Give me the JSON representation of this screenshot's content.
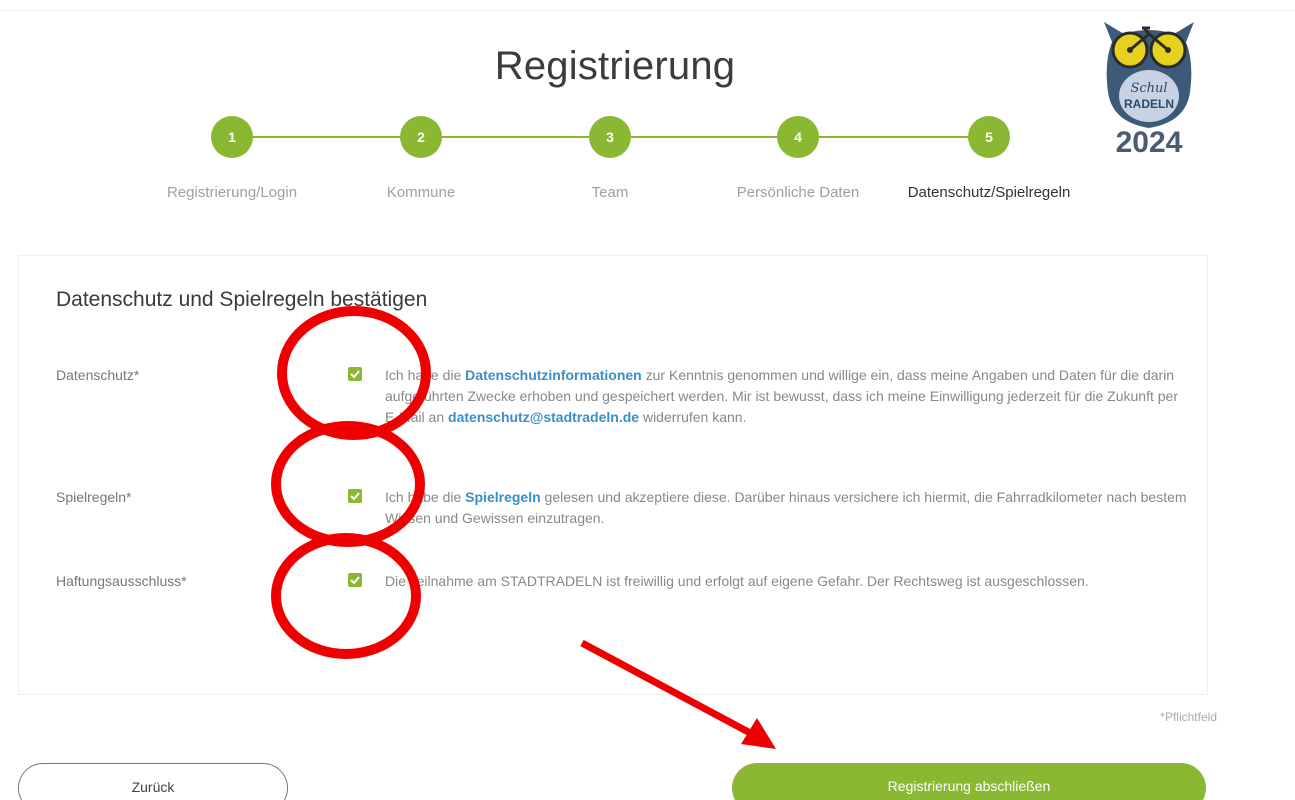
{
  "page": {
    "title": "Registrierung"
  },
  "logo": {
    "text_top": "Schul",
    "text_bottom": "RADELN",
    "year": "2024"
  },
  "stepper": {
    "steps": [
      {
        "number": "1",
        "label": "Registrierung/Login"
      },
      {
        "number": "2",
        "label": "Kommune"
      },
      {
        "number": "3",
        "label": "Team"
      },
      {
        "number": "4",
        "label": "Persönliche Daten"
      },
      {
        "number": "5",
        "label": "Datenschutz/Spielregeln"
      }
    ],
    "active_index": 4
  },
  "card": {
    "title": "Datenschutz und Spielregeln bestätigen",
    "rows": [
      {
        "label": "Datenschutz*",
        "checked": true,
        "text_1": "Ich habe die ",
        "link_1": "Datenschutzinformationen",
        "text_2": " zur Kenntnis genommen und willige ein, dass meine Angaben und Daten für die darin aufgeführten Zwecke erhoben und gespeichert werden. Mir ist bewusst, dass ich meine Einwilligung jederzeit für die Zukunft per E-Mail an ",
        "link_2": "datenschutz@stadtradeln.de",
        "text_3": " widerrufen kann."
      },
      {
        "label": "Spielregeln*",
        "checked": true,
        "text_1": "Ich habe die ",
        "link_1": "Spielregeln",
        "text_2": " gelesen und akzeptiere diese. Darüber hinaus versichere ich hiermit, die Fahrradkilometer nach bestem Wissen und Gewissen einzutragen."
      },
      {
        "label": "Haftungsausschluss*",
        "checked": true,
        "text_1": "Die Teilnahme am STADTRADELN ist freiwillig und erfolgt auf eigene Gefahr. Der Rechtsweg ist ausgeschlossen."
      }
    ]
  },
  "required_note": "*Pflichtfeld",
  "buttons": {
    "back_label": "Zurück",
    "submit_label": "Registrierung abschließen"
  },
  "colors": {
    "accent_green": "#8ab833",
    "link_blue": "#3b8fc7",
    "annotation_red": "#ee0000"
  }
}
